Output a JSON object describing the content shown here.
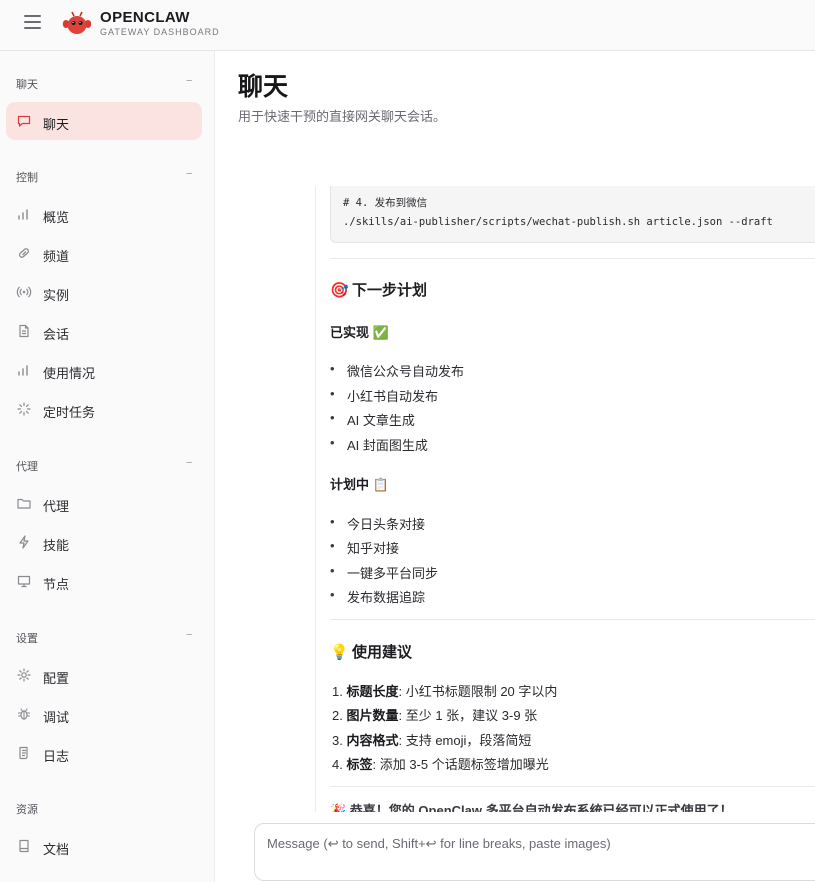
{
  "header": {
    "brand_title": "OPENCLAW",
    "brand_subtitle": "GATEWAY DASHBOARD"
  },
  "sidebar": {
    "sections": [
      {
        "title": "聊天",
        "items": [
          {
            "label": "聊天",
            "icon": "chat-bubble-icon",
            "active": true
          }
        ]
      },
      {
        "title": "控制",
        "items": [
          {
            "label": "概览",
            "icon": "bar-chart-icon"
          },
          {
            "label": "频道",
            "icon": "link-icon"
          },
          {
            "label": "实例",
            "icon": "broadcast-icon"
          },
          {
            "label": "会话",
            "icon": "document-icon"
          },
          {
            "label": "使用情况",
            "icon": "bar-chart-icon"
          },
          {
            "label": "定时任务",
            "icon": "spinner-icon"
          }
        ]
      },
      {
        "title": "代理",
        "items": [
          {
            "label": "代理",
            "icon": "folder-icon"
          },
          {
            "label": "技能",
            "icon": "lightning-icon"
          },
          {
            "label": "节点",
            "icon": "monitor-icon"
          }
        ]
      },
      {
        "title": "设置",
        "items": [
          {
            "label": "配置",
            "icon": "gear-icon"
          },
          {
            "label": "调试",
            "icon": "bug-icon"
          },
          {
            "label": "日志",
            "icon": "scroll-icon"
          }
        ]
      },
      {
        "title": "资源",
        "items": [
          {
            "label": "文档",
            "icon": "book-icon"
          }
        ]
      }
    ],
    "collapse_symbol": "−"
  },
  "main": {
    "title": "聊天",
    "subtitle": "用于快速干预的直接网关聊天会话。"
  },
  "chat": {
    "code_lines": [
      "# 4. 发布到微信",
      "./skills/ai-publisher/scripts/wechat-publish.sh article.json --draft"
    ],
    "plan": {
      "emoji": "🎯",
      "heading": "下一步计划",
      "done_label": "已实现",
      "done_emoji": "✅",
      "done_items": [
        "微信公众号自动发布",
        "小红书自动发布",
        "AI 文章生成",
        "AI 封面图生成"
      ],
      "todo_label": "计划中",
      "todo_emoji": "📋",
      "todo_items": [
        "今日头条对接",
        "知乎对接",
        "一键多平台同步",
        "发布数据追踪"
      ]
    },
    "tips": {
      "emoji": "💡",
      "heading": "使用建议",
      "items": [
        {
          "n": "1.",
          "key": "标题长度",
          "text": ": 小红书标题限制 20 字以内"
        },
        {
          "n": "2.",
          "key": "图片数量",
          "text": ": 至少 1 张，建议 3-9 张"
        },
        {
          "n": "3.",
          "key": "内容格式",
          "text": ": 支持 emoji，段落简短"
        },
        {
          "n": "4.",
          "key": "标签",
          "text": ": 添加 3-5 个话题标签增加曝光"
        }
      ]
    },
    "cutoff_text": "🎉 恭喜！您的 OpenClaw 多平台自动发布系统已经可以正式使用了！"
  },
  "composer": {
    "placeholder": "Message (↩ to send, Shift+↩ for line breaks, paste images)"
  },
  "colors": {
    "accent": "#e2413b",
    "active_bg": "#fbe3e2"
  }
}
